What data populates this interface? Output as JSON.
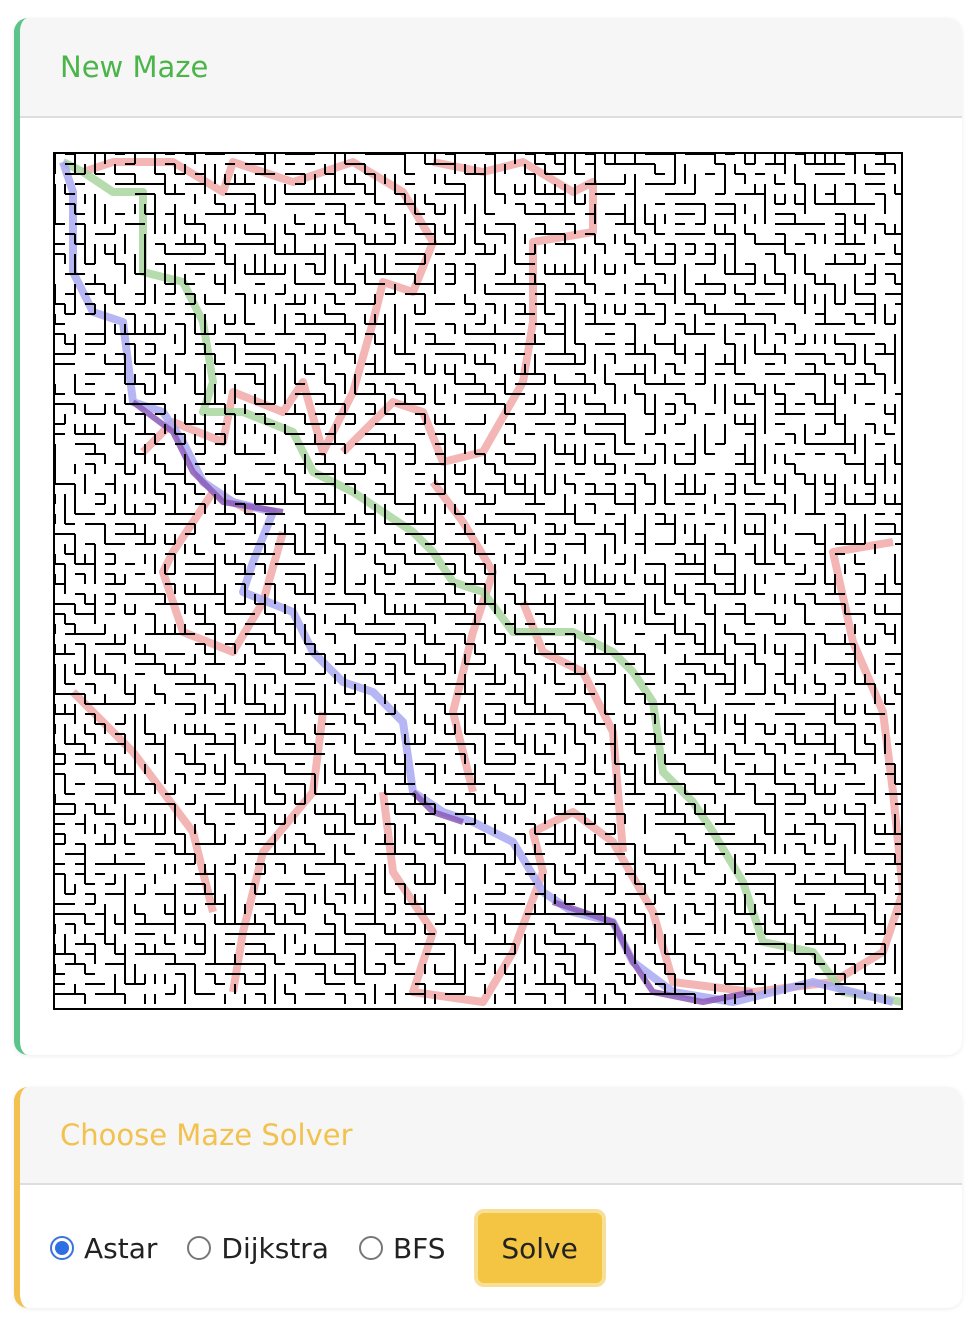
{
  "maze_card": {
    "title": "New Maze",
    "accent_color": "#5cc48a",
    "title_color": "#4bb54a"
  },
  "solver_card": {
    "title": "Choose Maze Solver",
    "accent_color": "#f2c14e",
    "options": [
      {
        "label": "Astar",
        "checked": true
      },
      {
        "label": "Dijkstra",
        "checked": false
      },
      {
        "label": "BFS",
        "checked": false
      }
    ],
    "solve_label": "Solve"
  },
  "path_colors": {
    "explored": "#f2a8a8",
    "path_green": "#a9d6a0",
    "path_blue": "#a9a9f2",
    "path_purple": "#8b5bb8"
  }
}
